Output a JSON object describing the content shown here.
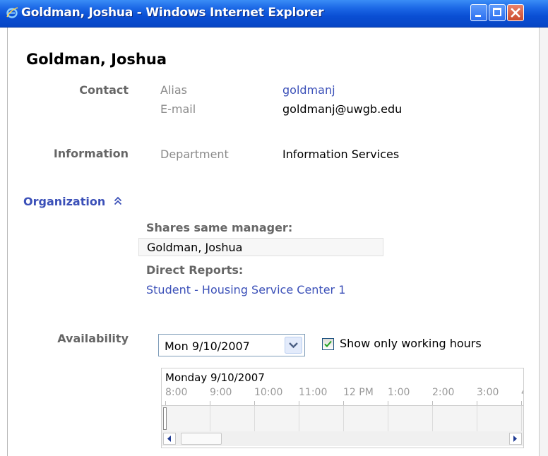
{
  "window": {
    "title": "Goldman, Joshua - Windows Internet Explorer",
    "icon": "ie-logo-icon",
    "controls": [
      "minimize",
      "maximize",
      "close"
    ],
    "titlebar_color": "#0a4fd4"
  },
  "person": {
    "name": "Goldman, Joshua"
  },
  "contact": {
    "section_label": "Contact",
    "alias_label": "Alias",
    "alias_value": "goldmanj",
    "email_label": "E-mail",
    "email_value": "goldmanj@uwgb.edu"
  },
  "information": {
    "section_label": "Information",
    "department_label": "Department",
    "department_value": "Information Services"
  },
  "organization": {
    "section_label": "Organization",
    "toggle_icon": "collapse-up-chevron-icon",
    "shares_manager_label": "Shares same manager:",
    "shares_manager_value": "Goldman, Joshua",
    "direct_reports_label": "Direct Reports:",
    "direct_reports": [
      "Student - Housing Service Center 1"
    ]
  },
  "availability": {
    "section_label": "Availability",
    "date_value": "Mon 9/10/2007",
    "working_hours_label": "Show only working hours",
    "working_hours_checked": true,
    "day_heading": "Monday 9/10/2007",
    "times": [
      "8:00",
      "9:00",
      "10:00",
      "11:00",
      "12 PM",
      "1:00",
      "2:00",
      "3:00",
      "4"
    ]
  },
  "colors": {
    "link": "#3b50b8",
    "section_label": "#666666",
    "field_label": "#8a8a8a"
  }
}
